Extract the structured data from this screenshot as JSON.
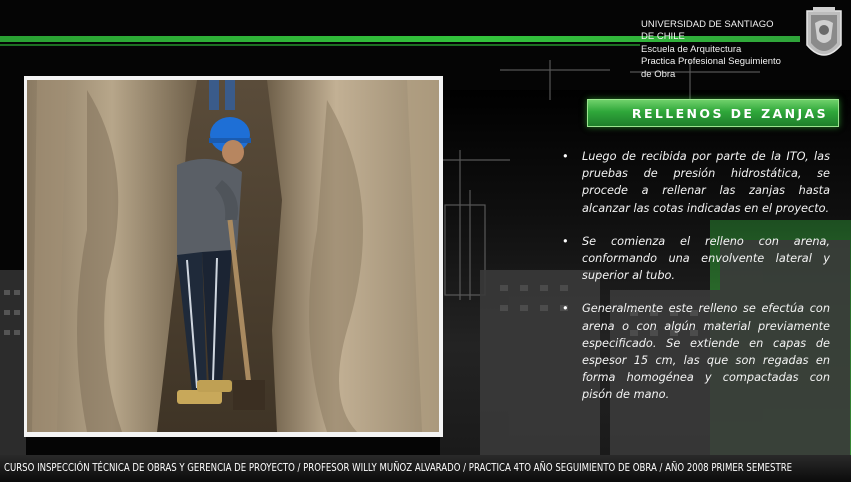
{
  "institution": {
    "lines": [
      "UNIVERSIDAD DE SANTIAGO",
      "DE CHILE",
      "Escuela  de Arquitectura",
      "Practica Profesional Seguimiento",
      "de Obra"
    ]
  },
  "slide": {
    "title": "RELLENOS DE ZANJAS",
    "bullets": [
      "Luego de recibida por parte de la ITO, las pruebas de presión hidrostática, se procede a rellenar las zanjas hasta alcanzar las cotas indicadas en el proyecto.",
      "Se comienza el relleno con arena, conformando una envolvente lateral y superior al tubo.",
      "Generalmente este relleno se efectúa con arena o con algún material previamente especificado. Se extiende en capas de espesor 15 cm, las que son regadas en forma homogénea y compactadas con pisón de mano."
    ],
    "bullet_glyph": "•"
  },
  "footer": {
    "text": "CURSO INSPECCIÓN TÉCNICA DE OBRAS Y GERENCIA DE PROYECTO /  PROFESOR  WILLY MUÑOZ ALVARADO /  PRACTICA 4TO AÑO SEGUIMIENTO DE OBRA / AÑO 2008 PRIMER SEMESTRE"
  },
  "photo": {
    "subject": "worker-in-trench-photo"
  },
  "colors": {
    "accent_green": "#2fa73a",
    "background": "#050505",
    "text": "#f4f4f4"
  }
}
